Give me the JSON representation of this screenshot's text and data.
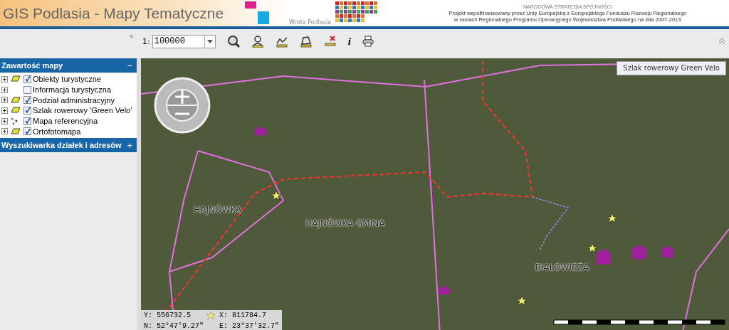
{
  "header": {
    "title": "GIS Podlasia - Mapy Tematyczne",
    "logo_caption": "Wrota Podlasia",
    "funding_strategy": "NARODOWA STRATEGIA SPÓJNOŚCI",
    "funding_note": "Projekt współfinansowany przez Unię Europejską z Europejskiego Funduszu Rozwoju Regionalnego",
    "funding_note_2": "w ramach Regionalnego Programu Operacyjnego Województwa Podlaskiego na lata 2007-2013"
  },
  "toolbar": {
    "scale_prefix": "1:",
    "scale_value": "100000",
    "info_label": "i"
  },
  "sidebar": {
    "panels": [
      {
        "title": "Zawartość mapy",
        "toggle": "−",
        "layers": [
          {
            "label": "Obiekty turystyczne",
            "checked": true,
            "kind": "polygon"
          },
          {
            "label": "Informacja turystyczna",
            "checked": false,
            "kind": "none"
          },
          {
            "label": "Podział administracyjny",
            "checked": true,
            "kind": "polygon"
          },
          {
            "label": "Szlak rowerowy 'Green Velo'",
            "checked": true,
            "kind": "polygon"
          },
          {
            "label": "Mapa referencyjna",
            "checked": true,
            "kind": "reference"
          },
          {
            "label": "Ortofotomapa",
            "checked": true,
            "kind": "polygon"
          }
        ]
      },
      {
        "title": "Wyszukiwarka działek i adresów",
        "toggle": "+"
      }
    ],
    "collapse_label": "«"
  },
  "map": {
    "legend": "Szlak rowerowy Green Velo",
    "labels": [
      {
        "text": "HAJNÓWKA"
      },
      {
        "text": "HAJNÓWKA GMINA"
      },
      {
        "text": "BIAŁOWIEŻA"
      }
    ],
    "coordinates": {
      "y": "Y: 556732.5",
      "x": "X: 811784.7",
      "n": "N: 52°47'9.27\"",
      "e": "E: 23°37'32.7\""
    }
  }
}
